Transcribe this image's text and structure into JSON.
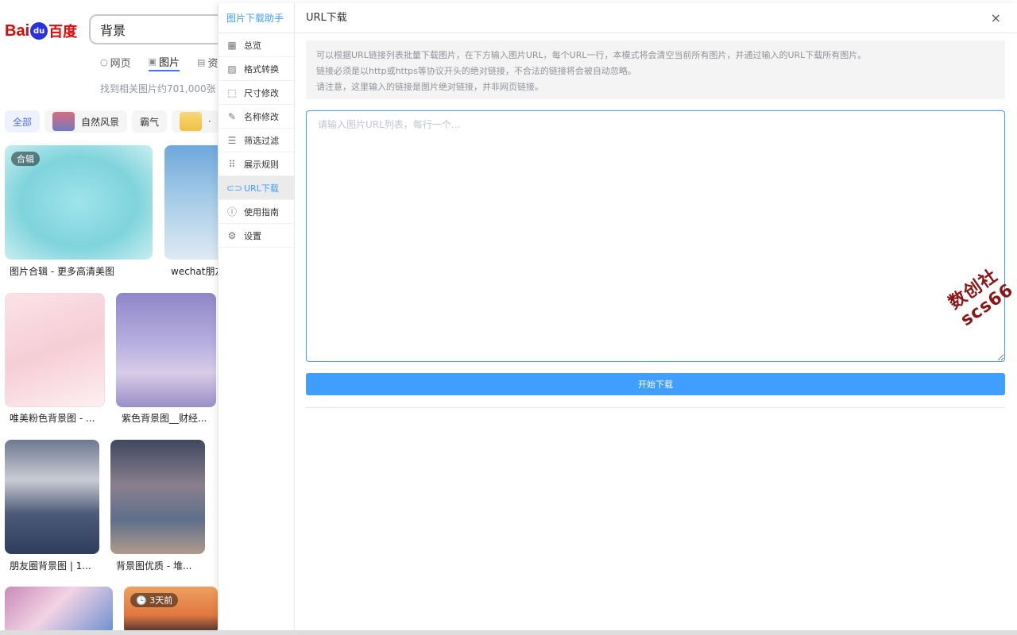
{
  "baidu": {
    "logo_bai": "Bai",
    "logo_paw": "du",
    "logo_cn": "百度",
    "search_query": "背景",
    "tabs": [
      {
        "icon": "○",
        "label": "网页"
      },
      {
        "icon": "▣",
        "label": "图片"
      },
      {
        "icon": "▤",
        "label": "资"
      }
    ],
    "result_count": "找到相关图片约701,000张",
    "chips": [
      "全部",
      "自然风景",
      "霸气",
      "·"
    ],
    "images": [
      {
        "badge": "合辑",
        "caption": "图片合辑 - 更多高清美图"
      },
      {
        "caption": "wechat朋友"
      },
      {
        "caption": "唯美粉色背景图 - ..."
      },
      {
        "caption": "紫色背景图__财经..."
      },
      {
        "caption": "朋友圈背景图 | 1..."
      },
      {
        "caption": "背景图优质 - 堆..."
      },
      {
        "caption": ""
      },
      {
        "badge": "3天前",
        "caption": ""
      }
    ]
  },
  "panel": {
    "side_title": "图片下载助手",
    "menu": [
      {
        "icon": "grid-icon",
        "glyph": "▦",
        "label": "总览"
      },
      {
        "icon": "image-icon",
        "glyph": "▨",
        "label": "格式转换"
      },
      {
        "icon": "crop-icon",
        "glyph": "⬚",
        "label": "尺寸修改"
      },
      {
        "icon": "edit-icon",
        "glyph": "✎",
        "label": "名称修改"
      },
      {
        "icon": "filter-icon",
        "glyph": "☰",
        "label": "筛选过滤"
      },
      {
        "icon": "apps-icon",
        "glyph": "⠿",
        "label": "展示规则"
      },
      {
        "icon": "link-icon",
        "glyph": "⊂⊃",
        "label": "URL下载"
      },
      {
        "icon": "info-icon",
        "glyph": "ⓘ",
        "label": "使用指南"
      },
      {
        "icon": "gear-icon",
        "glyph": "⚙",
        "label": "设置"
      }
    ],
    "active_index": 6,
    "header_title": "URL下载",
    "close_label": "×",
    "notice_lines": [
      "可以根据URL链接列表批量下载图片，在下方输入图片URL，每个URL一行，本模式将会清空当前所有图片，并通过输入的URL下载所有图片。",
      "链接必须是以http或https等协议开头的绝对链接，不合法的链接将会被自动忽略。",
      "请注意，这里输入的链接是图片绝对链接，并非网页链接。"
    ],
    "textarea_value": "",
    "textarea_placeholder": "请输入图片URL列表，每行一个...",
    "download_button": "开始下载",
    "watermark": "数创社scs66"
  }
}
